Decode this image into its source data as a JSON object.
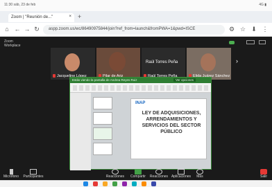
{
  "status": {
    "time": "11:30 sáb, 23 de feb",
    "right": "4G ▮"
  },
  "browser": {
    "tab_title": "Zoom | \"Reunión de...\"",
    "tab_close": "×",
    "new_tab": "+",
    "url": "aspp.zoom.us/wc/86490975844/join?ref_from=launch&fromPWA=1&pwd=ISCE"
  },
  "zoom": {
    "meeting_label": "Zoom\nWorkplace",
    "participants": [
      {
        "name": "Jacqueline López",
        "face": "#c98a6a",
        "bg": "#5b5f63"
      },
      {
        "name": "Pilar de Ariz",
        "face": "#7a4a36",
        "bg": "#6a4b3b"
      },
      {
        "name": "Raúl Torres Peña",
        "face": "",
        "bg": "#2d2d2d"
      },
      {
        "name": "Elida Juárez Sánchez",
        "face": "#a5735a",
        "bg": "#7b6d62"
      }
    ],
    "center_name": "Raúl Torres Peña",
    "share_bar": "Estás viendo la pantalla de Andrea Reyes Ruiz",
    "view_options": "Ver opciones",
    "slide": {
      "logo": "INAP",
      "title": "LEY DE ADQUISICIONES, ARRENDAMIENTOS Y SERVICIOS DEL SECTOR PÚBLICO"
    },
    "controls": [
      {
        "label": "Micrófono",
        "icon": "mic-icon"
      },
      {
        "label": "Participantes",
        "icon": "participants-icon"
      },
      {
        "label": "Reacciones",
        "icon": "reactions-icon"
      },
      {
        "label": "Compartir",
        "icon": "share-icon"
      },
      {
        "label": "Reacciones",
        "icon": "heart-icon"
      },
      {
        "label": "Aplicaciones",
        "icon": "apps-icon"
      },
      {
        "label": "Más",
        "icon": "more-icon"
      },
      {
        "label": "Salir",
        "icon": "leave-icon"
      }
    ]
  },
  "taskbar": {
    "colors": [
      "#1e88e5",
      "#e53935",
      "#f9a825",
      "#43a047",
      "#8e24aa",
      "#00acc1",
      "#fb8c00",
      "#3949ab"
    ]
  }
}
